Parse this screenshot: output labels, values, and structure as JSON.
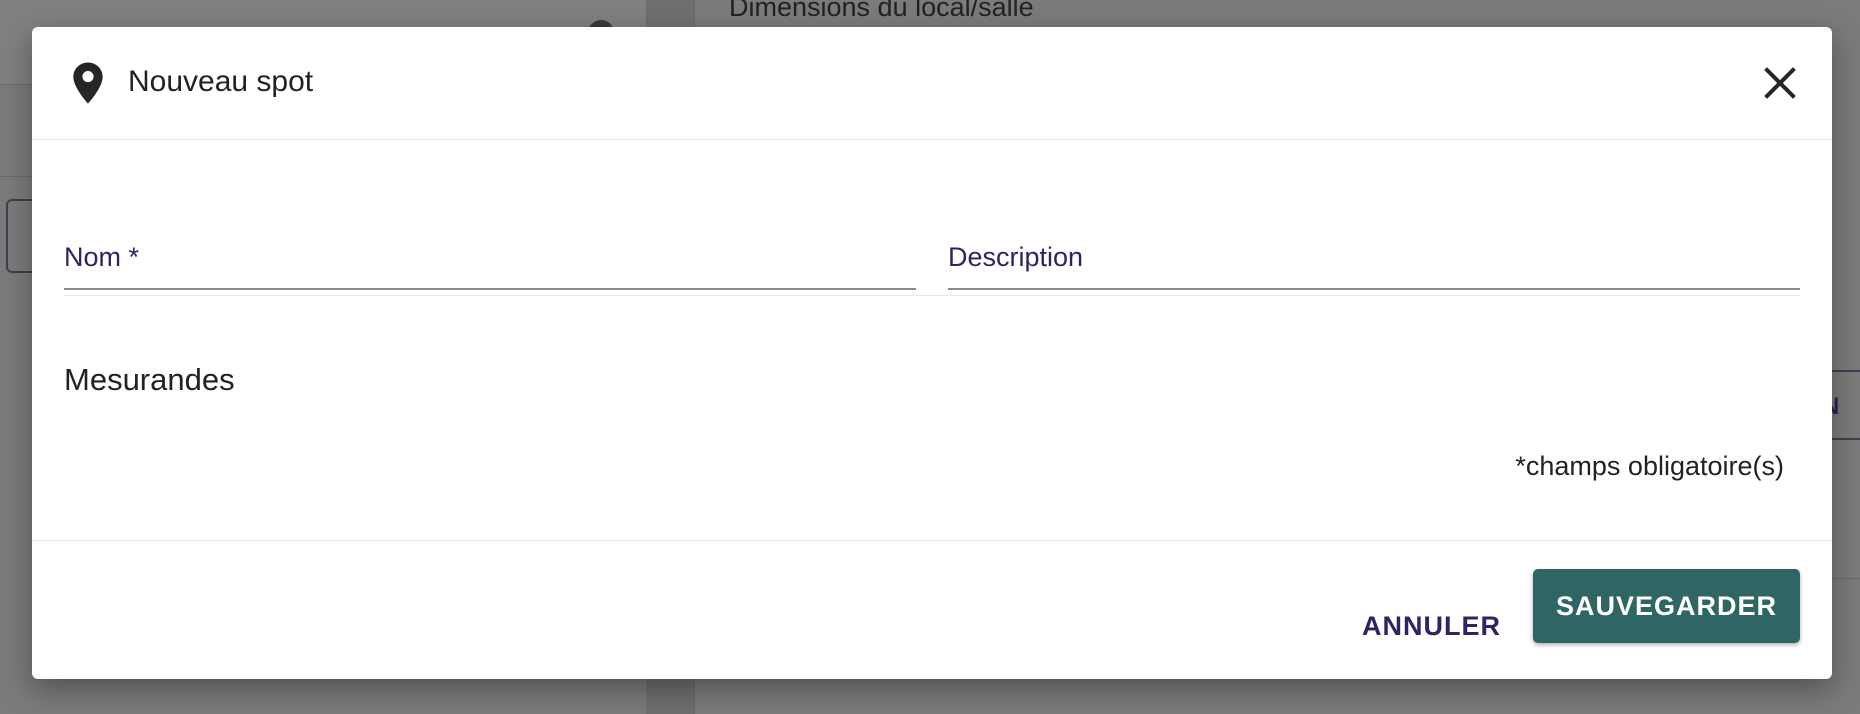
{
  "background": {
    "page_title": "Dimensions du local/salle",
    "right_button_fragment": "N"
  },
  "dialog": {
    "title": "Nouveau spot",
    "title_icon": "location-pin-icon",
    "close_icon": "close-icon",
    "fields": {
      "nom": {
        "label": "Nom *",
        "value": ""
      },
      "description": {
        "label": "Description",
        "value": ""
      }
    },
    "section_title": "Mesurandes",
    "required_note": "*champs obligatoire(s)",
    "actions": {
      "cancel_label": "ANNULER",
      "save_label": "SAUVEGARDER"
    },
    "colors": {
      "primary": "#2f6663",
      "label": "#2b2564"
    }
  }
}
